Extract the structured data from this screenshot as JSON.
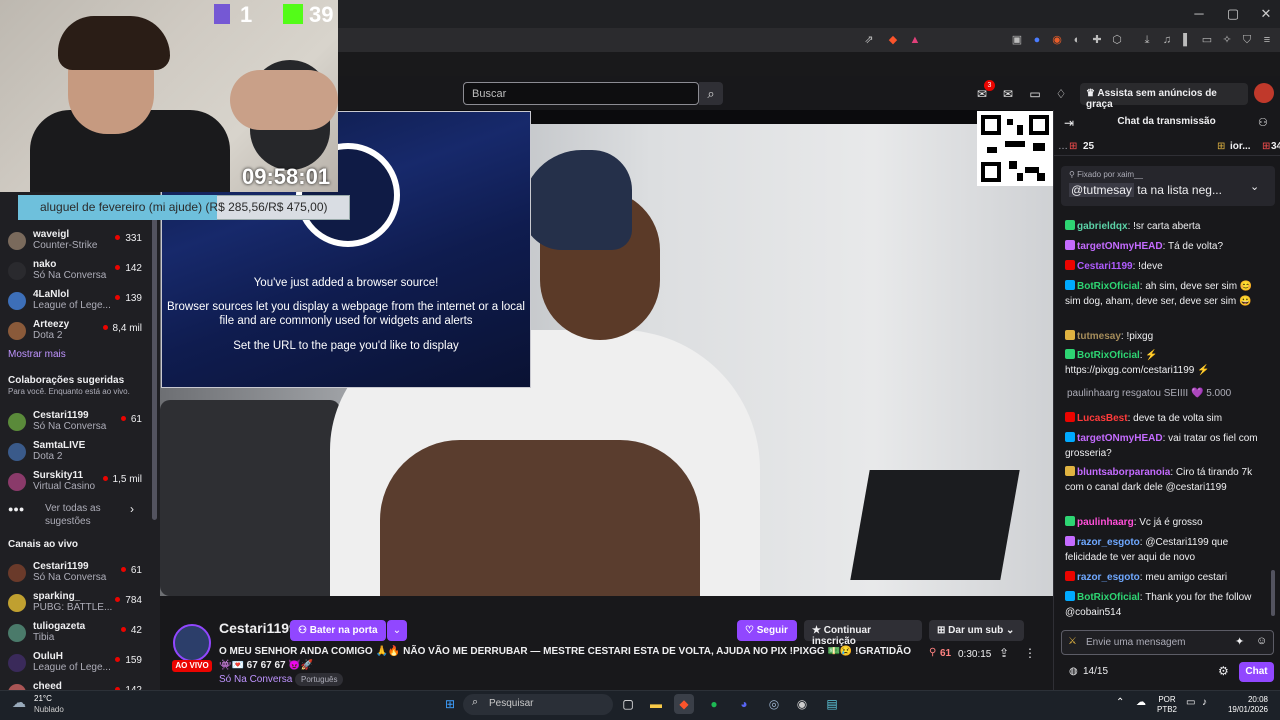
{
  "header": {
    "search_placeholder": "Buscar",
    "notifications_count": "3",
    "ad_free_label": "Assista sem anúncios de graça"
  },
  "overlay": {
    "counter_l": "1",
    "counter_k": "39",
    "clock": "09:58:01",
    "goal_text": "aluguel de fevereiro (mi ajude) (R$ 285,56/R$ 475,00)",
    "goal_progress_fraction": 0.6
  },
  "obs_dialog": {
    "line1": "You've just added a browser source!",
    "line2": "Browser sources let you display a webpage from the internet or a local file and are commonly used for widgets and alerts",
    "line3": "Set the URL to the page you'd like to display"
  },
  "sidebar": {
    "followed": [
      {
        "name": "waveigl",
        "game": "Counter-Strike",
        "viewers": "331"
      },
      {
        "name": "nako",
        "game": "Só Na Conversa",
        "viewers": "142"
      },
      {
        "name": "4LaNlol",
        "game": "League of Lege...",
        "viewers": "139"
      },
      {
        "name": "Arteezy",
        "game": "Dota 2",
        "viewers": "8,4 mil"
      }
    ],
    "show_more": "Mostrar mais",
    "suggested_title": "Colaborações sugeridas",
    "suggested_subtitle": "Para você. Enquanto está ao vivo.",
    "suggested": [
      {
        "name": "Cestari1199",
        "game": "Só Na Conversa",
        "viewers": "61"
      },
      {
        "name": "SamtaLIVE",
        "game": "Dota 2",
        "viewers": ""
      },
      {
        "name": "Surskity11",
        "game": "Virtual Casino",
        "viewers": "1,5 mil"
      }
    ],
    "see_all": "Ver todas as sugestões",
    "live_title": "Canais ao vivo",
    "live": [
      {
        "name": "Cestari1199",
        "game": "Só Na Conversa",
        "viewers": "61"
      },
      {
        "name": "sparking_",
        "game": "PUBG: BATTLE...",
        "viewers": "784"
      },
      {
        "name": "tuliogazeta",
        "game": "Tibia",
        "viewers": "42"
      },
      {
        "name": "OuluH",
        "game": "League of Lege...",
        "viewers": "159"
      },
      {
        "name": "cheed",
        "game": "",
        "viewers": "142"
      }
    ]
  },
  "stream": {
    "channel": "Cestari1199",
    "live_badge": "AO VIVO",
    "knock_label": "Bater na porta",
    "follow_label": "Seguir",
    "continue_sub_label": "Continuar inscrição",
    "give_sub_label": "Dar um sub",
    "title": "O MEU SENHOR ANDA COMIGO 🙏🔥 NÃO VÃO ME DERRUBAR — MESTRE CESTARI ESTA DE VOLTA, AJUDA NO PIX !PIXGG 💵😢 !GRATIDÃO 👾💌 67 67 67 😈🚀",
    "game": "Só Na Conversa",
    "language": "Português",
    "viewers": "61",
    "uptime": "0:30:15"
  },
  "chat": {
    "title": "Chat da transmissão",
    "gift_left": "25",
    "gift_right_name": "ior...",
    "gift_right_count": "34",
    "pinned_by": "Fixado por",
    "pinned_by_user": "xaim__",
    "pinned_user": "@tutmesay",
    "pinned_text": "ta na lista neg...",
    "messages": [
      {
        "user": "gabrieldqx",
        "color": "#5cd3a8",
        "text": "!sr carta aberta"
      },
      {
        "user": "targetONmyHEAD",
        "color": "#c46bff",
        "text": "Tá de volta?"
      },
      {
        "user": "Cestari1199",
        "color": "#b05cff",
        "text": "!deve"
      },
      {
        "user": "BotRixOficial",
        "color": "#2ed573",
        "text": "ah sim, deve ser sim 😊 sim dog, aham, deve ser, deve ser sim 😀"
      },
      {
        "user": "tutmesay",
        "color": "#a58c5a",
        "text": "!pixgg"
      },
      {
        "user": "BotRixOficial",
        "color": "#2ed573",
        "text": "⚡ https://pixgg.com/cestari1199 ⚡"
      },
      {
        "user": "",
        "color": "#adadb8",
        "text": "paulinhaarg resgatou SEIIII 💜 5.000"
      },
      {
        "user": "LucasBest",
        "color": "#ff3b3b",
        "text": "deve ta de volta sim"
      },
      {
        "user": "targetONmyHEAD",
        "color": "#c46bff",
        "text": "vai tratar os fiel com grosseria?"
      },
      {
        "user": "bluntsaborparanoia",
        "color": "#c46bff",
        "text": "Ciro tá tirando 7k com o canal dark dele @cestari1199"
      },
      {
        "user": "paulinhaarg",
        "color": "#ff4fd8",
        "text": "Vc já é grosso"
      },
      {
        "user": "razor_esgoto",
        "color": "#6fa8ff",
        "text": "@Cestari1199 que felicidade te ver aqui de novo"
      },
      {
        "user": "razor_esgoto",
        "color": "#6fa8ff",
        "text": "meu amigo cestari"
      },
      {
        "user": "BotRixOficial",
        "color": "#2ed573",
        "text": "Thank you for the follow @cobain514"
      }
    ],
    "input_placeholder": "Envie uma mensagem",
    "points": "14/15",
    "send_label": "Chat"
  },
  "taskbar": {
    "temperature": "21°C",
    "weather": "Nublado",
    "search_placeholder": "Pesquisar",
    "lang_1": "POR",
    "lang_2": "PTB2",
    "time": "20:08",
    "date": "19/01/2026"
  },
  "colors": {
    "twitch_purple": "#9147ff",
    "live_red": "#eb0400",
    "chat_bg": "#18181b"
  }
}
